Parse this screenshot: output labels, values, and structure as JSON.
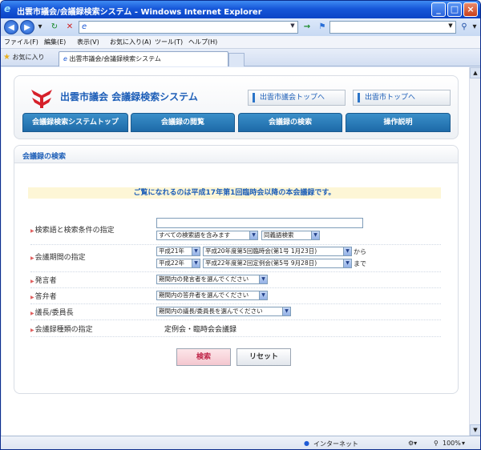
{
  "window": {
    "title": "出雲市議会/会議録検索システム - Windows Internet Explorer"
  },
  "address": {
    "url_prefix": "e"
  },
  "menubar": [
    "ファイル(F)",
    "編集(E)",
    "表示(V)",
    "お気に入り(A)",
    "ツール(T)",
    "ヘルプ(H)"
  ],
  "tabbar": {
    "favorites": "お気に入り",
    "tab_title": "出雲市議会/会議録検索システム"
  },
  "site": {
    "title": "出雲市議会 会議録検索システム",
    "link_council_top": "出雲市議会トップへ",
    "link_city_top": "出雲市トップへ"
  },
  "nav": [
    "会議録検索システムトップ",
    "会議録の閲覧",
    "会議録の検索",
    "操作説明"
  ],
  "search": {
    "heading": "会議録の検索",
    "notice": "ご覧になれるのは平成17年第1回臨時会以降の本会議録です。",
    "rows": {
      "keyword": {
        "label": "検索語と検索条件の指定",
        "value": "",
        "condition": "すべての検索語を含みます",
        "synonym": "同義語検索"
      },
      "period": {
        "label": "会議期間の指定",
        "from_year": "平成21年",
        "from_meeting": "平成20年度第5回臨時会(第1号 1月23日)",
        "from_suffix": "から",
        "to_year": "平成22年",
        "to_meeting": "平成22年度第2回定例会(第5号 9月28日)",
        "to_suffix": "まで"
      },
      "speaker": {
        "label": "発言者",
        "value": "期間内の発言者を選んでください"
      },
      "answerer": {
        "label": "答弁者",
        "value": "期間内の答弁者を選んでください"
      },
      "chair": {
        "label": "議長/委員長",
        "value": "期間内の議長/委員長を選んでください"
      },
      "kind": {
        "label": "会議録種類の指定",
        "value": "定例会・臨時会会議録"
      }
    },
    "search_button": "検索",
    "reset_button": "リセット"
  },
  "status": {
    "zone": "インターネット",
    "zoom": "100%"
  }
}
